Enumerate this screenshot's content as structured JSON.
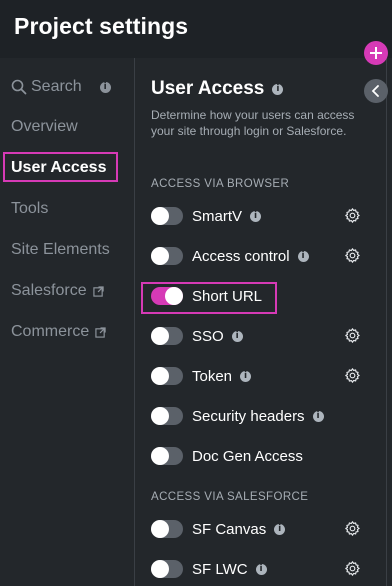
{
  "header": {
    "title": "Project settings"
  },
  "sidebar": {
    "search_label": "Search",
    "info_glyph": "i",
    "items": [
      {
        "label": "Overview"
      },
      {
        "label": "User Access"
      },
      {
        "label": "Tools"
      },
      {
        "label": "Site Elements"
      },
      {
        "label": "Salesforce"
      },
      {
        "label": "Commerce"
      }
    ]
  },
  "main": {
    "title": "User Access",
    "description": "Determine how your users can access your site through login or Salesforce.",
    "groups": [
      {
        "label": "ACCESS VIA BROWSER",
        "rows": [
          {
            "label": "SmartV",
            "on": false,
            "info": true,
            "settings": true
          },
          {
            "label": "Access control",
            "on": false,
            "info": true,
            "settings": true
          },
          {
            "label": "Short URL",
            "on": true,
            "info": false,
            "settings": false
          },
          {
            "label": "SSO",
            "on": false,
            "info": true,
            "settings": true
          },
          {
            "label": "Token",
            "on": false,
            "info": true,
            "settings": true
          },
          {
            "label": "Security headers",
            "on": false,
            "info": true,
            "settings": false
          },
          {
            "label": "Doc Gen Access",
            "on": false,
            "info": false,
            "settings": false
          }
        ]
      },
      {
        "label": "ACCESS VIA SALESFORCE",
        "rows": [
          {
            "label": "SF Canvas",
            "on": false,
            "info": true,
            "settings": true
          },
          {
            "label": "SF LWC",
            "on": false,
            "info": true,
            "settings": true
          }
        ]
      }
    ]
  },
  "colors": {
    "accent": "#d63ab6",
    "background": "#23272b",
    "toggle_off": "#5b6169"
  },
  "icons": {
    "add": "plus-icon",
    "collapse": "chevron-left-icon",
    "settings": "gear-icon",
    "external": "external-link-icon",
    "search": "search-icon"
  }
}
